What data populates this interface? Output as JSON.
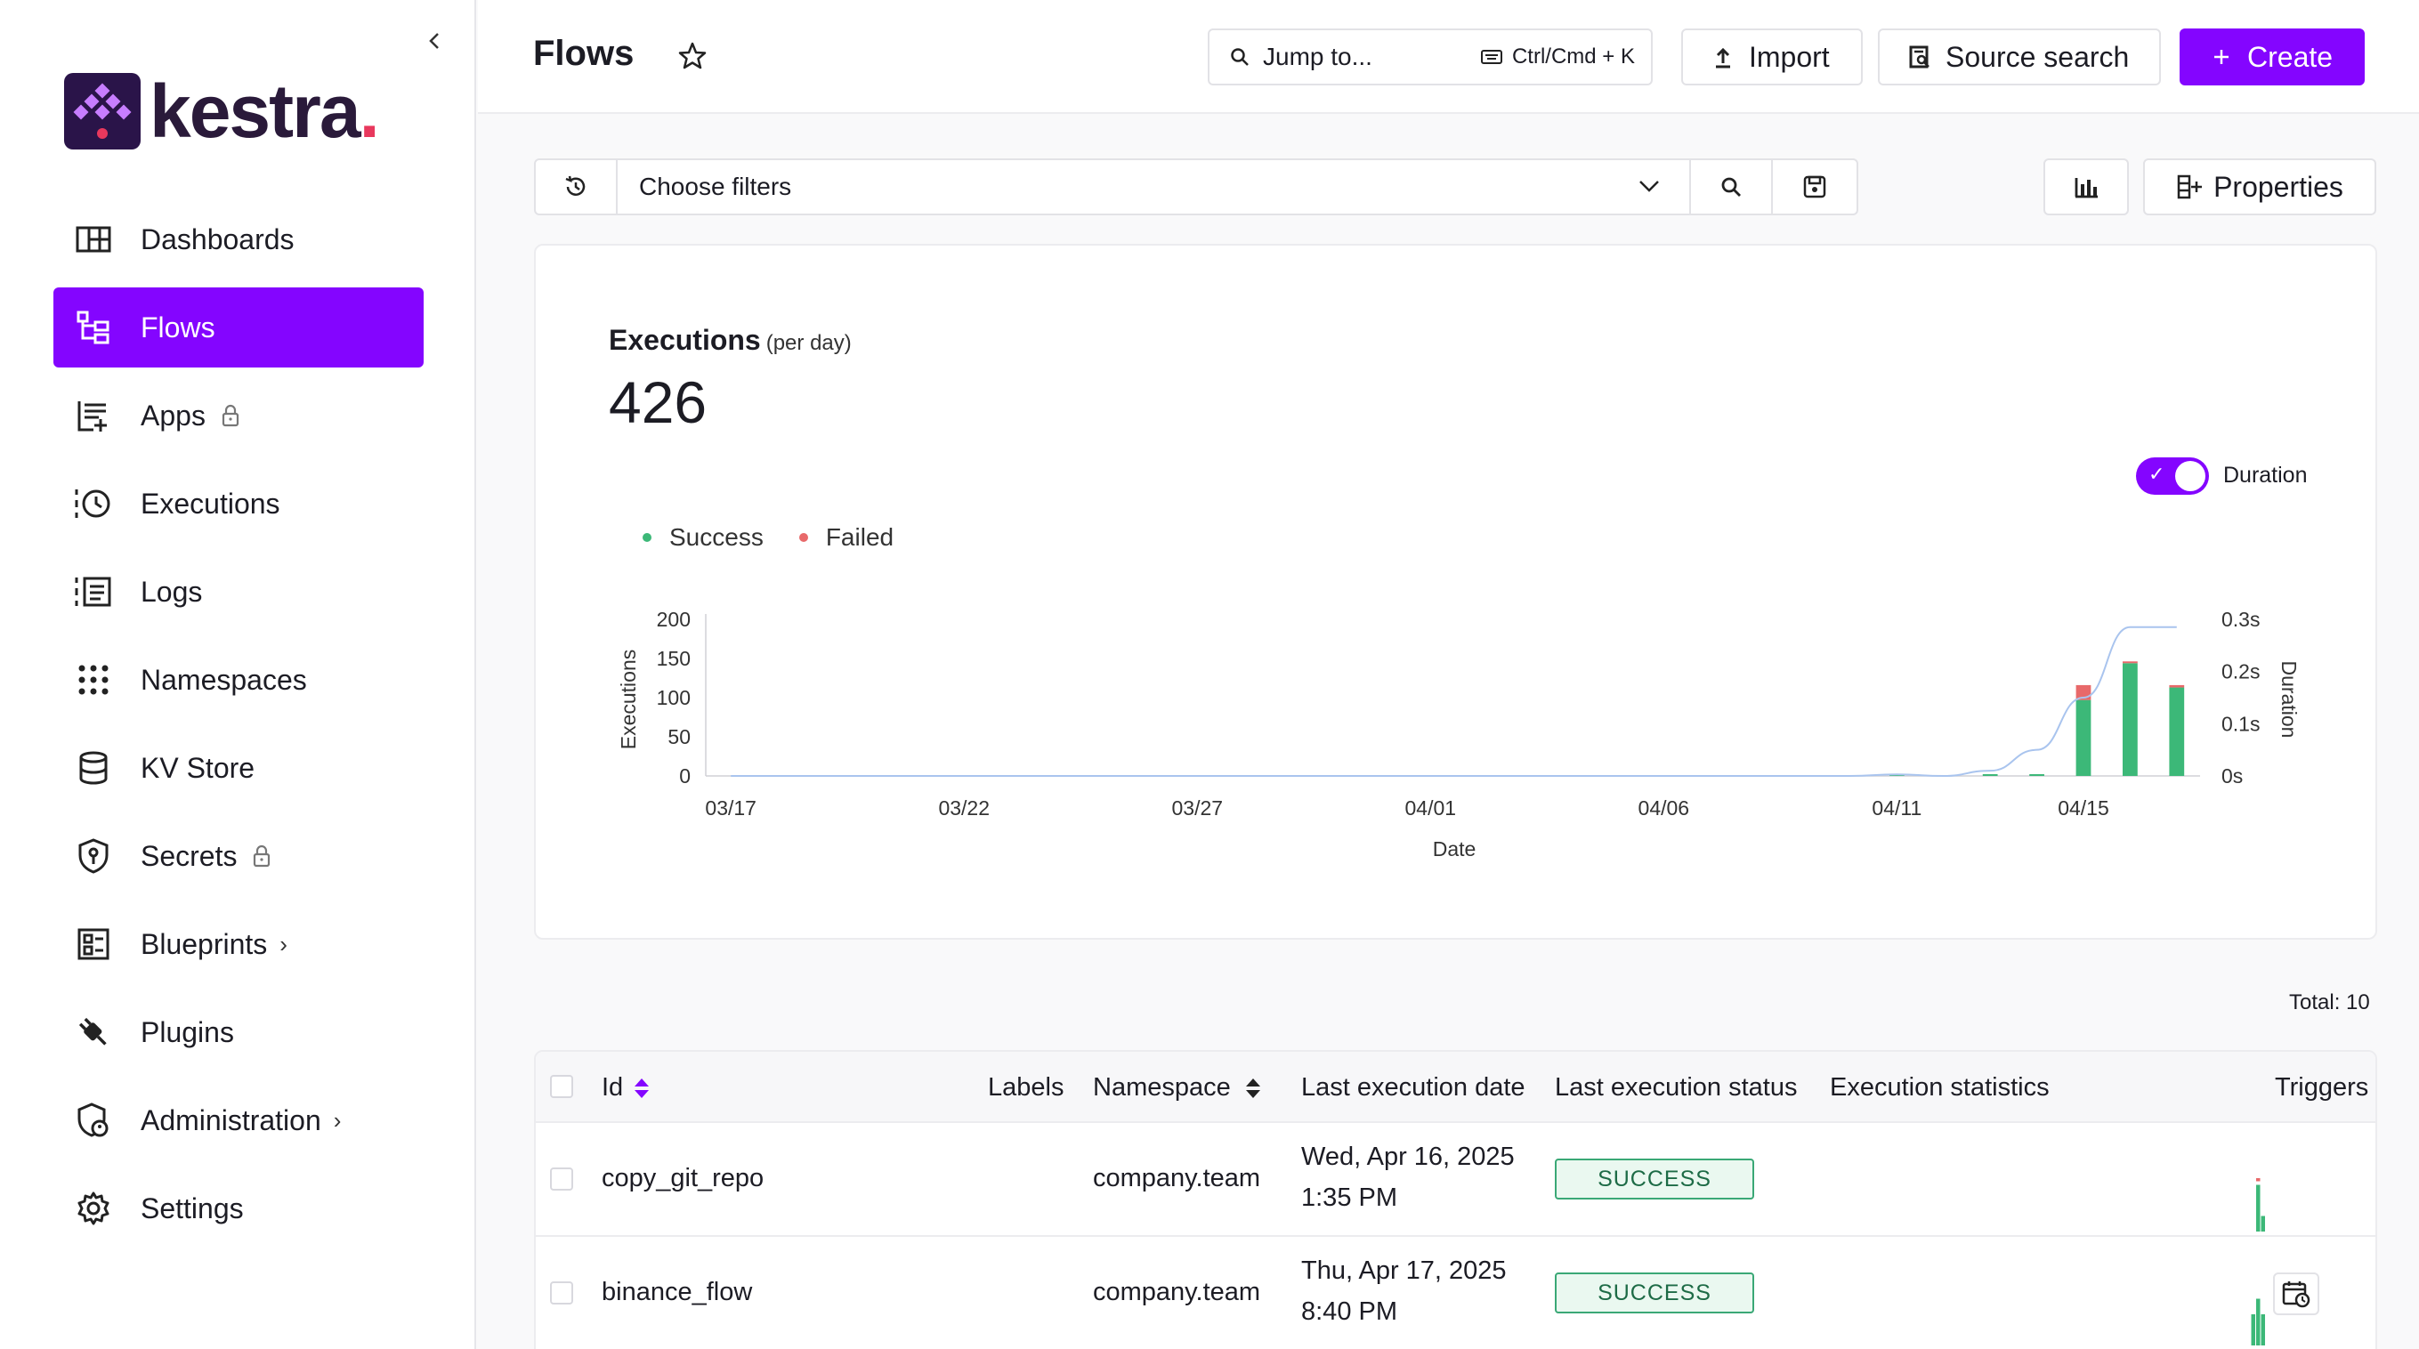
{
  "sidebar": {
    "logo_text": "kestra",
    "logo_dot": ".",
    "items": [
      {
        "label": "Dashboards",
        "icon": "dashboard-icon"
      },
      {
        "label": "Flows",
        "icon": "flows-icon",
        "active": true
      },
      {
        "label": "Apps",
        "icon": "apps-icon",
        "locked": true
      },
      {
        "label": "Executions",
        "icon": "executions-icon"
      },
      {
        "label": "Logs",
        "icon": "logs-icon"
      },
      {
        "label": "Namespaces",
        "icon": "namespaces-icon"
      },
      {
        "label": "KV Store",
        "icon": "database-icon"
      },
      {
        "label": "Secrets",
        "icon": "shield-key-icon",
        "locked": true
      },
      {
        "label": "Blueprints",
        "icon": "blueprints-icon",
        "expandable": true
      },
      {
        "label": "Plugins",
        "icon": "plug-icon"
      },
      {
        "label": "Administration",
        "icon": "admin-icon",
        "expandable": true
      },
      {
        "label": "Settings",
        "icon": "gear-icon"
      }
    ]
  },
  "header": {
    "title": "Flows",
    "jump_label": "Jump to...",
    "jump_shortcut": "Ctrl/Cmd + K",
    "import_label": "Import",
    "source_search_label": "Source search",
    "create_label": "Create"
  },
  "filters": {
    "placeholder": "Choose filters",
    "properties_label": "Properties"
  },
  "chart_card": {
    "title": "Executions",
    "subtitle": "(per day)",
    "total": "426",
    "duration_toggle_label": "Duration",
    "duration_toggle_on": true
  },
  "chart_data": {
    "type": "bar",
    "xlabel": "Date",
    "ylabel": "Executions",
    "y2label": "Duration",
    "ylim": [
      0,
      200
    ],
    "y2lim": [
      0,
      0.3
    ],
    "yticks": [
      "200",
      "150",
      "100",
      "50",
      "0"
    ],
    "y2ticks": [
      "0.3s",
      "0.2s",
      "0.1s",
      "0s"
    ],
    "xticks": [
      "03/17",
      "03/22",
      "03/27",
      "04/01",
      "04/06",
      "04/11",
      "04/15"
    ],
    "categories": [
      "03/17",
      "03/18",
      "03/19",
      "03/20",
      "03/21",
      "03/22",
      "03/23",
      "03/24",
      "03/25",
      "03/26",
      "03/27",
      "03/28",
      "03/29",
      "03/30",
      "03/31",
      "04/01",
      "04/02",
      "04/03",
      "04/04",
      "04/05",
      "04/06",
      "04/07",
      "04/08",
      "04/09",
      "04/10",
      "04/11",
      "04/12",
      "04/13",
      "04/14",
      "04/15",
      "04/16",
      "04/17"
    ],
    "series": [
      {
        "name": "Success",
        "color": "#3cb878",
        "values": [
          0,
          0,
          0,
          0,
          0,
          0,
          0,
          0,
          0,
          0,
          0,
          0,
          0,
          0,
          0,
          0,
          0,
          0,
          0,
          0,
          0,
          0,
          0,
          0,
          0,
          1,
          0,
          1,
          1,
          97,
          144,
          113
        ]
      },
      {
        "name": "Failed",
        "color": "#e8696a",
        "values": [
          0,
          0,
          0,
          0,
          0,
          0,
          0,
          0,
          0,
          0,
          0,
          0,
          0,
          0,
          0,
          0,
          0,
          0,
          0,
          0,
          0,
          0,
          0,
          0,
          0,
          0,
          0,
          0,
          0,
          19,
          2,
          3
        ]
      }
    ],
    "duration": {
      "name": "Duration",
      "color": "#a9c4ee",
      "values": [
        0,
        0,
        0,
        0,
        0,
        0,
        0,
        0,
        0,
        0,
        0,
        0,
        0,
        0,
        0,
        0,
        0,
        0,
        0,
        0,
        0,
        0,
        0,
        0,
        0,
        0.003,
        0,
        0.01,
        0.05,
        0.15,
        0.285,
        0.285
      ]
    },
    "legend": [
      "Success",
      "Failed"
    ]
  },
  "table": {
    "total_label": "Total: 10",
    "columns": [
      "Id",
      "Labels",
      "Namespace",
      "Last execution date",
      "Last execution status",
      "Execution statistics",
      "Triggers"
    ],
    "rows": [
      {
        "id": "copy_git_repo",
        "namespace": "company.team",
        "date_line1": "Wed, Apr 16, 2025",
        "date_line2": "1:35 PM",
        "status": "SUCCESS",
        "has_trigger": false,
        "stats": {
          "success": [
            0,
            0,
            0,
            0,
            0,
            0,
            0,
            0,
            0,
            0,
            0,
            0,
            0,
            0,
            0,
            0,
            0,
            0,
            0,
            3,
            1
          ],
          "failed": [
            0,
            0,
            0,
            0,
            0,
            0,
            0,
            0,
            0,
            0,
            0,
            0,
            0,
            0,
            0,
            0,
            0,
            0,
            0,
            1,
            0
          ]
        }
      },
      {
        "id": "binance_flow",
        "namespace": "company.team",
        "date_line1": "Thu, Apr 17, 2025",
        "date_line2": "8:40 PM",
        "status": "SUCCESS",
        "has_trigger": true,
        "stats": {
          "success": [
            0,
            0,
            0,
            0,
            0,
            0,
            0,
            0,
            0,
            0,
            0,
            0,
            0,
            0,
            0,
            0,
            0,
            0,
            2,
            3,
            2
          ],
          "failed": [
            0,
            0,
            0,
            0,
            0,
            0,
            0,
            0,
            0,
            0,
            0,
            0,
            0,
            0,
            0,
            0,
            0,
            0,
            0,
            0,
            0
          ]
        }
      }
    ]
  },
  "colors": {
    "accent": "#8405ff",
    "success": "#3cb878",
    "failed": "#e8696a",
    "duration_line": "#a9c4ee"
  }
}
